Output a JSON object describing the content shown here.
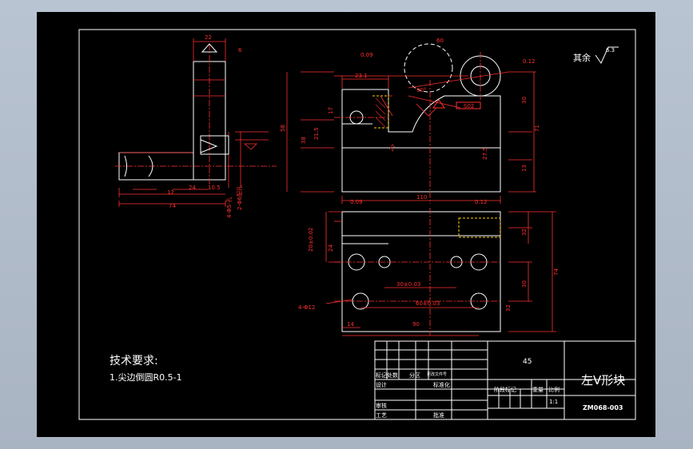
{
  "drawing": {
    "tech_req_title": "技术要求:",
    "tech_req_item": "1.尖边倒圆R0.5-1",
    "surface_note": "其余",
    "surface_roughness": "6.3"
  },
  "title_block": {
    "material": "45",
    "part_name": "左V形块",
    "drawing_no": "ZM068-003",
    "labels": {
      "mark_zone": "标记处数",
      "zone": "分区",
      "change_doc": "更改文件号",
      "design": "设计",
      "standardize": "标准化",
      "stage_mark": "阶段标记",
      "weight": "重量",
      "scale": "比例",
      "review": "审核",
      "process": "工艺",
      "approve": "批准"
    },
    "scale_value": "1:1"
  },
  "dimensions": {
    "side": [
      "22",
      "6",
      "17",
      "12",
      "24",
      "10.5",
      "74",
      "4-Φ5-孔",
      "2-Φ6配孔"
    ],
    "front": [
      "23.1",
      "17",
      "21.5",
      "38",
      "58",
      "110",
      "30",
      "71",
      "13",
      "27.5",
      "27",
      "60",
      "0.09",
      "0.12",
      "90°",
      "S02",
      "0.02",
      "0.02"
    ],
    "top": [
      "0.09",
      "0.12",
      "32",
      "24",
      "74",
      "30",
      "32",
      "30±0.03",
      "60±0.03",
      "4-Φ12",
      "14",
      "90",
      "20±0.02"
    ]
  },
  "colors": {
    "background": "#000000",
    "line_white": "#ffffff",
    "dim_red": "#ff3030",
    "hidden_yellow": "#ffd000",
    "frame_bg": "#b0bccb"
  }
}
